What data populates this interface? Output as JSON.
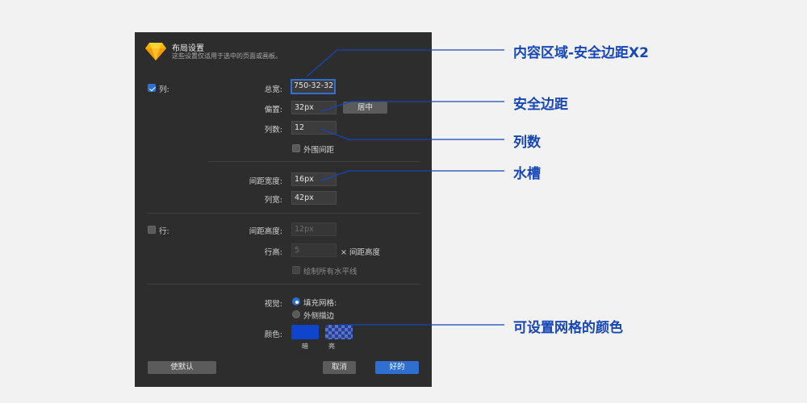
{
  "dialog": {
    "title": "布局设置",
    "subtitle": "这些设置仅适用于选中的页面或画板。",
    "columns": {
      "checkbox_label": "列:",
      "checked": true,
      "total_width_label": "总宽:",
      "total_width_value": "750-32-32",
      "offset_label": "偏置:",
      "offset_value": "32px",
      "center_button": "居中",
      "count_label": "列数:",
      "count_value": "12",
      "outer_gutter_label": "外围间距",
      "outer_gutter_checked": false,
      "gutter_width_label": "间距宽度:",
      "gutter_width_value": "16px",
      "column_width_label": "列宽:",
      "column_width_value": "42px"
    },
    "rows": {
      "checkbox_label": "行:",
      "checked": false,
      "gutter_height_label": "间距高度:",
      "gutter_height_value": "12px",
      "row_height_label": "行高:",
      "row_height_value": "5",
      "row_height_suffix": "× 间距高度",
      "draw_all_label": "绘制所有水平线",
      "draw_all_checked": false
    },
    "visual": {
      "label": "视觉:",
      "option_fill": "填充网格:",
      "option_stroke": "外侧描边",
      "selected": "填充网格",
      "color_label": "颜色:",
      "dark_label": "暗",
      "light_label": "亮",
      "dark_color": "#0f44cc",
      "light_color": "#2a3f8f"
    },
    "buttons": {
      "make_default": "使默认",
      "cancel": "取消",
      "ok": "好的"
    }
  },
  "annotations": {
    "content_area": "内容区域-安全边距X2",
    "safe_margin": "安全边距",
    "column_count": "列数",
    "gutter": "水槽",
    "grid_color": "可设置网格的颜色",
    "line_color": "#1746b8"
  }
}
